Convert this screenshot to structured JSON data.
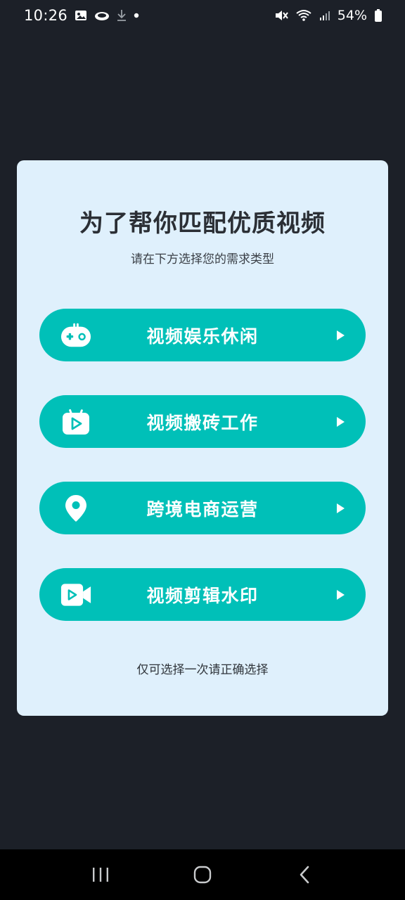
{
  "status_bar": {
    "time": "10:26",
    "battery": "54%",
    "icons": [
      "image-icon",
      "cloud-icon",
      "download-icon",
      "dot-icon",
      "mute-icon",
      "wifi-icon",
      "signal-icon",
      "battery-icon"
    ]
  },
  "card": {
    "title": "为了帮你匹配优质视频",
    "subtitle": "请在下方选择您的需求类型",
    "options": [
      {
        "label": "视频娱乐休闲",
        "icon": "gamepad-icon"
      },
      {
        "label": "视频搬砖工作",
        "icon": "tv-play-icon"
      },
      {
        "label": "跨境电商运营",
        "icon": "location-pin-icon"
      },
      {
        "label": "视频剪辑水印",
        "icon": "video-camera-icon"
      }
    ],
    "footnote": "仅可选择一次请正确选择"
  },
  "colors": {
    "background": "#1c2028",
    "card": "#dff0fc",
    "accent": "#00c0b8"
  },
  "nav_bar": {
    "buttons": [
      "recents-icon",
      "home-icon",
      "back-icon"
    ]
  }
}
